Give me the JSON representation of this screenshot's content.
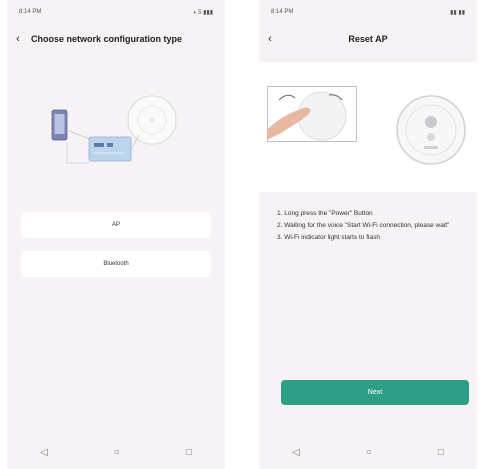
{
  "left_screen": {
    "status_time": "8:14 PM",
    "status_icons": "◖ 5 ▮▮▮",
    "back_glyph": "‹",
    "title": "Choose network configuration type",
    "options": [
      {
        "label": "AP"
      },
      {
        "label": "Bluetooth"
      }
    ]
  },
  "right_screen": {
    "status_time": "8:14 PM",
    "status_icons": "▮▮ ▮▮",
    "back_glyph": "‹",
    "title": "Reset AP",
    "steps": [
      "1. Long press the \"Power\" Button",
      "2. Waiting for the voice \"Start Wi-Fi connection, please wait\"",
      "3. Wi-Fi indicator light starts to flash"
    ],
    "next_label": "Next"
  },
  "navbar": {
    "back_glyph": "◁",
    "home_glyph": "○",
    "recent_glyph": "□"
  },
  "colors": {
    "accent": "#2e9e86",
    "screen_bg": "#f6f2f5"
  }
}
